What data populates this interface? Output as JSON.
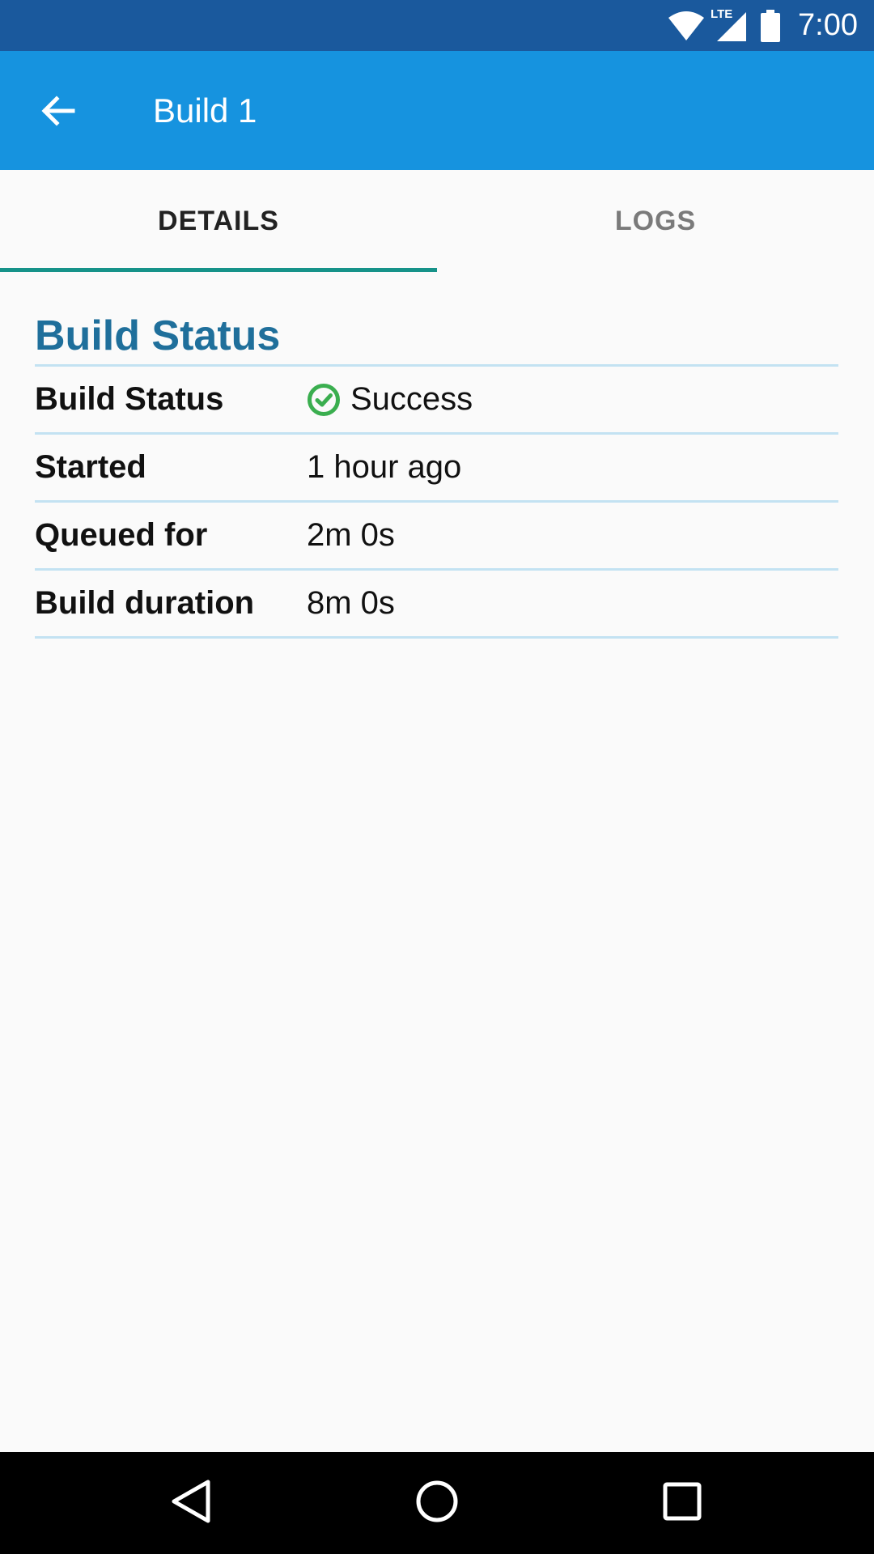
{
  "status_bar": {
    "time": "7:00",
    "network_label": "LTE",
    "icons": [
      "wifi-icon",
      "cell-signal-icon",
      "battery-icon"
    ]
  },
  "app_bar": {
    "title": "Build 1",
    "back_icon": "arrow-back-icon",
    "background_color": "#1693df"
  },
  "tabs": [
    {
      "label": "DETAILS",
      "active": true
    },
    {
      "label": "LOGS",
      "active": false
    }
  ],
  "section": {
    "title": "Build Status",
    "rows": [
      {
        "label": "Build Status",
        "value": "Success",
        "icon": "check-circle-icon"
      },
      {
        "label": "Started",
        "value": "1 hour ago"
      },
      {
        "label": "Queued for",
        "value": "2m 0s"
      },
      {
        "label": "Build duration",
        "value": "8m 0s"
      }
    ]
  },
  "colors": {
    "status_bar": "#1a599d",
    "accent_tab_indicator": "#169289",
    "section_title": "#1f6f9b",
    "success": "#3aae4f"
  },
  "nav_bar": {
    "icons": [
      "nav-back-icon",
      "nav-home-icon",
      "nav-recents-icon"
    ]
  }
}
